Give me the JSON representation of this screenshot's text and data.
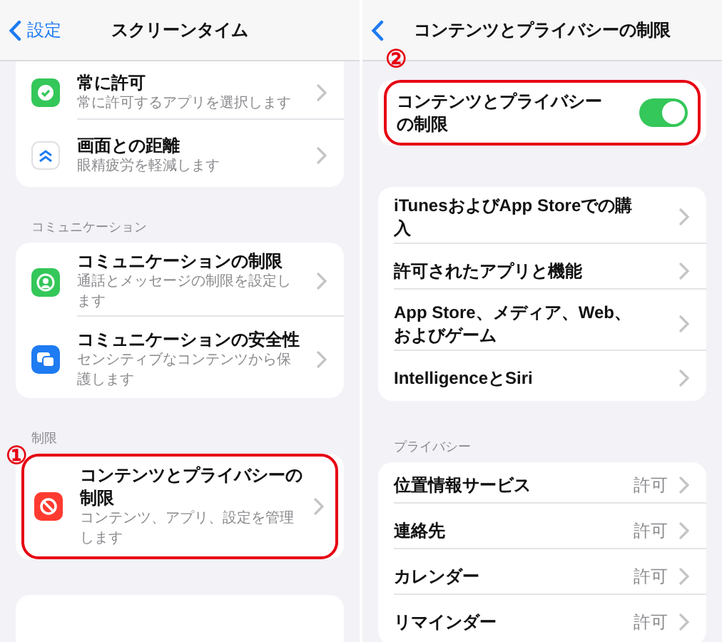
{
  "screens": [
    {
      "nav": {
        "back_label": "設定",
        "title": "スクリーンタイム"
      },
      "sections": [
        {
          "rows": [
            {
              "kind": "nav",
              "title": "常に許可",
              "subtitle": "常に許可するアプリを選択します",
              "highlighted": false
            },
            {
              "kind": "nav",
              "title": "画面との距離",
              "subtitle": "眼精疲労を軽減します",
              "highlighted": false
            }
          ]
        },
        {
          "header": "コミュニケーション",
          "rows": [
            {
              "kind": "nav",
              "title": "コミュニケーションの制限",
              "subtitle": "通話とメッセージの制限を設定します",
              "highlighted": false
            },
            {
              "kind": "nav",
              "title": "コミュニケーションの安全性",
              "subtitle": "センシティブなコンテンツから保護します",
              "highlighted": false
            }
          ]
        },
        {
          "header": "制限",
          "marker": "①",
          "rows": [
            {
              "kind": "nav",
              "title": "コンテンツとプライバシーの制限",
              "subtitle": "コンテンツ、アプリ、設定を管理します",
              "highlighted": true
            }
          ]
        }
      ]
    },
    {
      "nav": {
        "title": "コンテンツとプライバシーの制限"
      },
      "sections": [
        {
          "marker": "②",
          "rows": [
            {
              "kind": "toggle",
              "title": "コンテンツとプライバシーの制限",
              "on": true,
              "highlighted": true
            }
          ]
        },
        {
          "rows": [
            {
              "kind": "link",
              "title": "iTunesおよびApp Storeでの購入"
            },
            {
              "kind": "link",
              "title": "許可されたアプリと機能"
            },
            {
              "kind": "link",
              "title": "App Store、メディア、Web、およびゲーム"
            },
            {
              "kind": "link",
              "title": "IntelligenceとSiri"
            }
          ]
        },
        {
          "header": "プライバシー",
          "rows": [
            {
              "kind": "link",
              "title": "位置情報サービス",
              "value": "許可"
            },
            {
              "kind": "link",
              "title": "連絡先",
              "value": "許可"
            },
            {
              "kind": "link",
              "title": "カレンダー",
              "value": "許可"
            },
            {
              "kind": "link",
              "title": "リマインダー",
              "value": "許可"
            }
          ]
        }
      ]
    }
  ]
}
